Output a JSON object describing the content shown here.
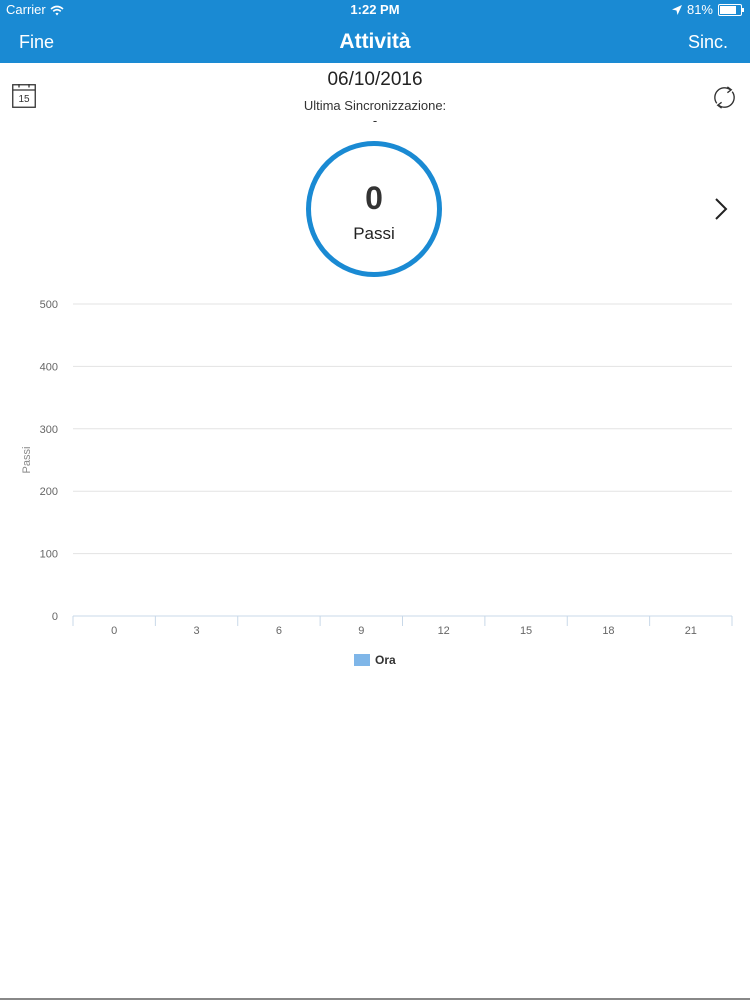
{
  "status_bar": {
    "carrier": "Carrier",
    "time": "1:22 PM",
    "battery": "81%",
    "battery_level": 0.81
  },
  "nav": {
    "back_label": "Fine",
    "title": "Attività",
    "sync_label": "Sinc."
  },
  "calendar_day": "15",
  "date": "06/10/2016",
  "last_sync_label": "Ultima Sincronizzazione:",
  "last_sync_value": "-",
  "steps": {
    "value": "0",
    "label": "Passi"
  },
  "colors": {
    "accent": "#1a8ad3",
    "series": "#7fb6e8",
    "grid": "#e3e3e3"
  },
  "icons": [
    "wifi-icon",
    "location-arrow-icon",
    "battery-icon",
    "calendar-icon",
    "refresh-icon",
    "chevron-right-icon"
  ],
  "chart_data": {
    "type": "bar",
    "ylabel": "Passi",
    "ylim": [
      0,
      500
    ],
    "yticks": [
      0,
      100,
      200,
      300,
      400,
      500
    ],
    "x_ticks": [
      "0",
      "3",
      "6",
      "9",
      "12",
      "15",
      "18",
      "21"
    ],
    "series": [
      {
        "name": "Ora",
        "values": [
          0,
          0,
          0,
          0,
          0,
          0,
          0,
          0
        ]
      }
    ],
    "grid": true,
    "legend": "bottom-center"
  }
}
